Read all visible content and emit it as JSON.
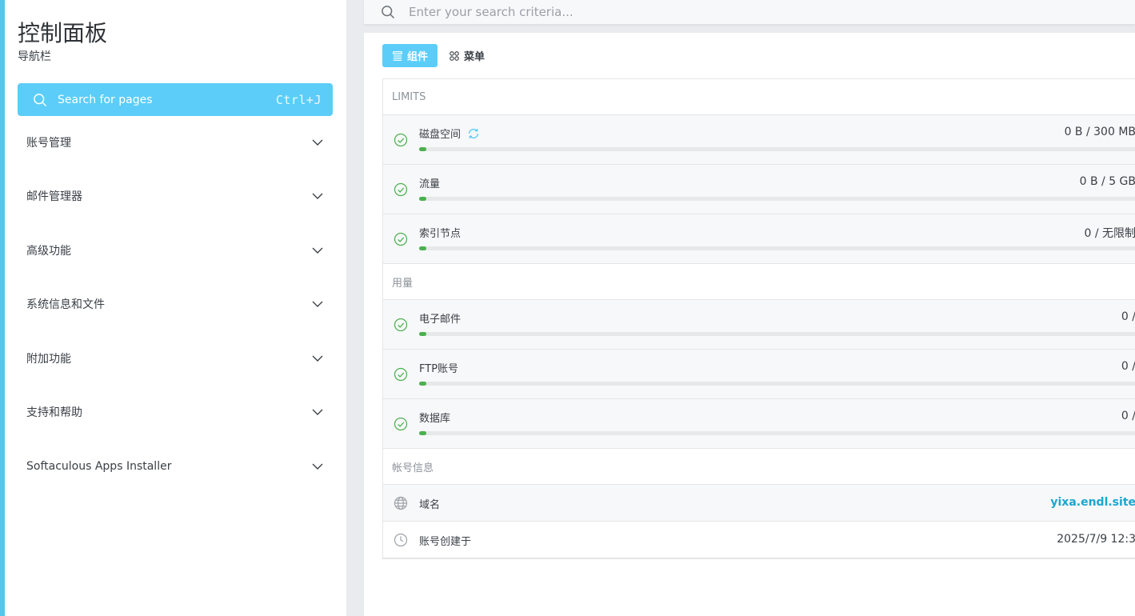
{
  "sidebar": {
    "title": "控制面板",
    "subtitle": "导航栏",
    "search": {
      "label": "Search for pages",
      "shortcut": "Ctrl+J"
    },
    "items": [
      {
        "label": "账号管理"
      },
      {
        "label": "邮件管理器"
      },
      {
        "label": "高级功能"
      },
      {
        "label": "系统信息和文件"
      },
      {
        "label": "附加功能"
      },
      {
        "label": "支持和帮助"
      },
      {
        "label": "Softaculous Apps Installer"
      }
    ]
  },
  "topbar": {
    "placeholder": "Enter your search criteria..."
  },
  "tabs": [
    {
      "label": "组件",
      "active": true
    },
    {
      "label": "菜单",
      "active": false
    }
  ],
  "limits": {
    "header": "LIMITS",
    "rows": [
      {
        "label": "磁盘空间",
        "value": "0 B / 300 MB",
        "fill": 0.01
      },
      {
        "label": "流量",
        "value": "0 B / 5 GB",
        "fill": 0.01
      },
      {
        "label": "索引节点",
        "value": "0 / 无限制",
        "fill": 0.01
      }
    ]
  },
  "usage": {
    "header": "用量",
    "rows": [
      {
        "label": "电子邮件",
        "value": "0 /",
        "fill": 0.01
      },
      {
        "label": "FTP账号",
        "value": "0 /",
        "fill": 0.01
      },
      {
        "label": "数据库",
        "value": "0 /",
        "fill": 0.01
      }
    ]
  },
  "account": {
    "header": "帐号信息",
    "domain_label": "域名",
    "domain_value": "yixa.endl.site",
    "created_label": "账号创建于",
    "created_value": "2025/7/9 12:3"
  },
  "colors": {
    "accent": "#5bcdf8",
    "success": "#4caf50",
    "link": "#1aa6d0"
  }
}
